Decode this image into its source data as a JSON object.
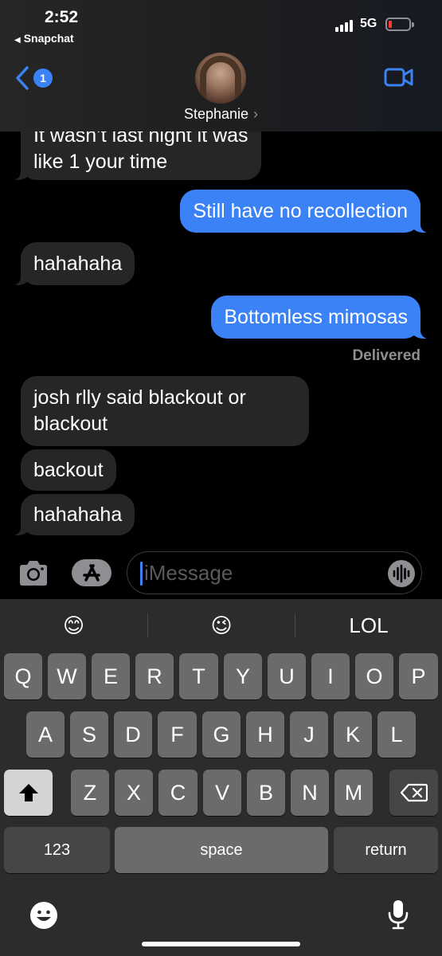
{
  "status_bar": {
    "time": "2:52",
    "back_app": "Snapchat",
    "network": "5G",
    "battery_color": "#ff3b30"
  },
  "header": {
    "back_badge_count": "1",
    "contact_name": "Stephanie",
    "chevron": "›",
    "back_icon": "chevron-left-icon",
    "video_icon": "video-camera-icon",
    "accent_color": "#3b82f6"
  },
  "messages": [
    {
      "from": "them",
      "text_line1": "It wasn’t last night it was",
      "text_line2": "like 1 your time"
    },
    {
      "from": "me",
      "text": "Still have no recollection"
    },
    {
      "from": "them",
      "text": "hahahaha"
    },
    {
      "from": "me",
      "text": "Bottomless mimosas"
    },
    {
      "from": "them",
      "text_line1": "josh rlly said blackout or",
      "text_line2": "blackout"
    },
    {
      "from": "them",
      "text": "backout"
    },
    {
      "from": "them",
      "text": "hahahaha"
    }
  ],
  "delivered_label": "Delivered",
  "compose": {
    "placeholder": "iMessage",
    "camera_icon": "camera-icon",
    "apps_icon": "app-store-icon",
    "audio_icon": "waveform-icon"
  },
  "keyboard": {
    "suggestions": [
      "😊",
      "😉",
      "LOL"
    ],
    "row1": [
      "Q",
      "W",
      "E",
      "R",
      "T",
      "Y",
      "U",
      "I",
      "O",
      "P"
    ],
    "row2": [
      "A",
      "S",
      "D",
      "F",
      "G",
      "H",
      "J",
      "K",
      "L"
    ],
    "row3": [
      "Z",
      "X",
      "C",
      "V",
      "B",
      "N",
      "M"
    ],
    "numbers_label": "123",
    "space_label": "space",
    "return_label": "return",
    "shift_icon": "shift-arrow-icon",
    "delete_icon": "backspace-icon",
    "emoji_icon": "emoji-icon",
    "mic_icon": "microphone-icon"
  }
}
